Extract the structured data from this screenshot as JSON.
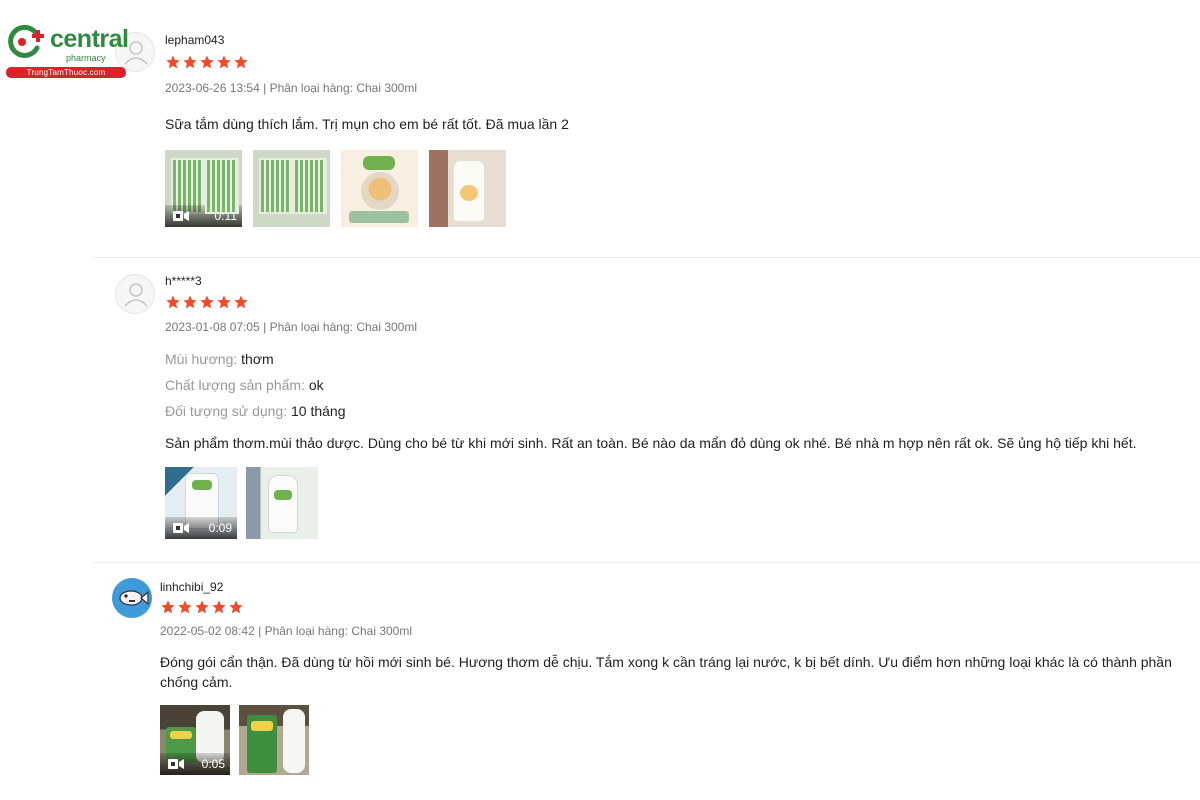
{
  "logo": {
    "brand": "central",
    "sub": "pharmacy",
    "site": "TrungTamThuoc.com"
  },
  "colors": {
    "star": "#ee4d2d",
    "brand_green": "#2e8a3e",
    "brand_red": "#d8232a"
  },
  "reviews": [
    {
      "username": "lepham043",
      "rating": 5,
      "date": "2023-06-26 13:54",
      "separator": "|",
      "variant_label": "Phân loại hàng:",
      "variant": "Chai 300ml",
      "attributes": [],
      "content": "Sữa tắm dùng thích lắm. Trị mụn cho em bé rất tốt. Đã mua lần 2",
      "video_duration": "0:11",
      "avatar_icon": "default-user-icon"
    },
    {
      "username": "h*****3",
      "rating": 5,
      "date": "2023-01-08 07:05",
      "separator": "|",
      "variant_label": "Phân loại hàng:",
      "variant": "Chai 300ml",
      "attributes": [
        {
          "label": "Mùi hương:",
          "value": "thơm"
        },
        {
          "label": "Chất lượng sản phẩm:",
          "value": "ok"
        },
        {
          "label": "Đối tượng sử dụng:",
          "value": "10 tháng"
        }
      ],
      "content": "Sản phẩm thơm.mùi thảo dược. Dùng cho bé từ khi mới sinh. Rất an toàn. Bé nào da mẩn đỏ dùng ok nhé. Bé nhà m hợp nên rất ok. Sẽ ủng hộ tiếp khi hết.",
      "video_duration": "0:09",
      "avatar_icon": "default-user-icon"
    },
    {
      "username": "linhchibi_92",
      "rating": 5,
      "date": "2022-05-02 08:42",
      "separator": "|",
      "variant_label": "Phân loại hàng:",
      "variant": "Chai 300ml",
      "attributes": [],
      "content": "Đóng gói cẩn thận. Đã dùng từ hồi mới sinh bé. Hương thơm dễ chịu. Tắm xong k cần tráng lại nước, k bị bết dính. Ưu điểm hơn những loại khác là có thành phần chống cảm.",
      "video_duration": "0:05",
      "avatar_icon": "fish-avatar-icon"
    }
  ]
}
